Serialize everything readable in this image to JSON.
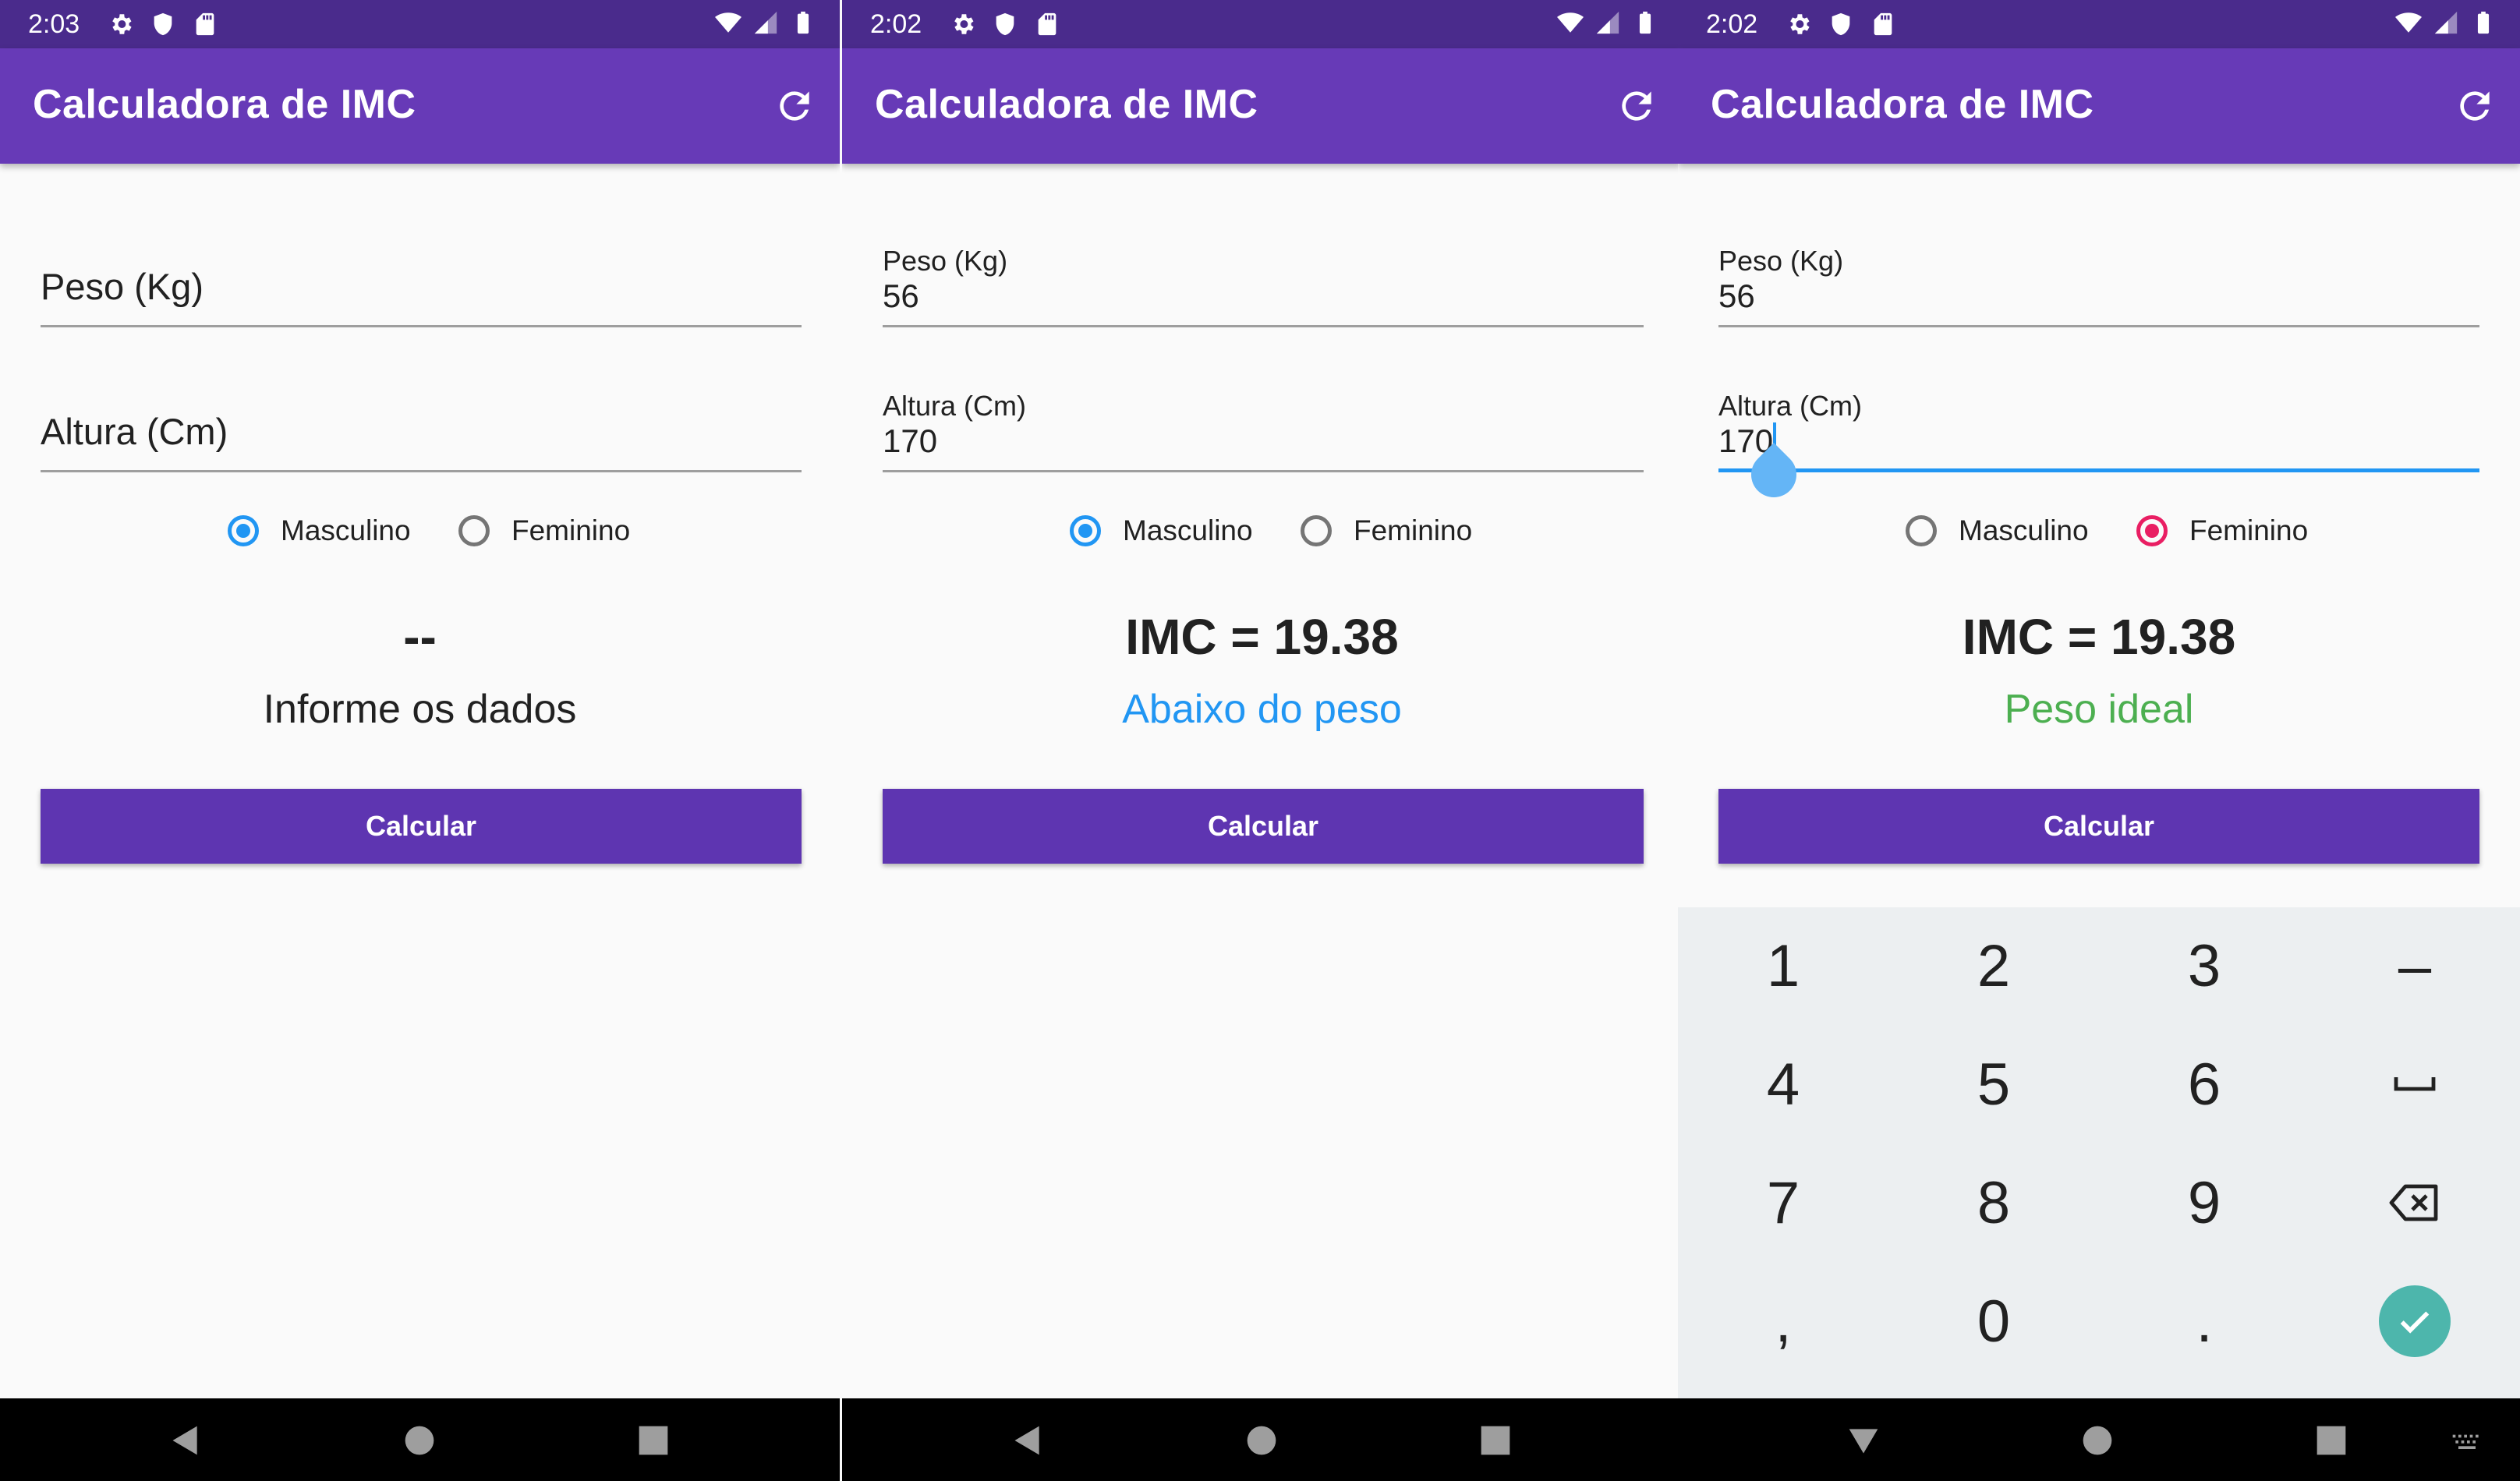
{
  "app": {
    "title": "Calculadora de IMC",
    "accent": "#673ab7",
    "button_color": "#5e35b1",
    "statusbar_color": "#4a2b8c"
  },
  "screens": [
    {
      "time": "2:03",
      "peso": {
        "label": "Peso (Kg)",
        "value": ""
      },
      "altura": {
        "label": "Altura (Cm)",
        "value": ""
      },
      "gender": {
        "masculino": "Masculino",
        "feminino": "Feminino",
        "selected": "masculino"
      },
      "result": "--",
      "status": "Informe os dados",
      "status_color": "#212121",
      "button": "Calcular"
    },
    {
      "time": "2:02",
      "peso": {
        "label": "Peso (Kg)",
        "value": "56"
      },
      "altura": {
        "label": "Altura (Cm)",
        "value": "170"
      },
      "gender": {
        "masculino": "Masculino",
        "feminino": "Feminino",
        "selected": "masculino"
      },
      "result": "IMC = 19.38",
      "status": "Abaixo do peso",
      "status_color": "#2196f3",
      "button": "Calcular"
    },
    {
      "time": "2:02",
      "peso": {
        "label": "Peso (Kg)",
        "value": "56"
      },
      "altura": {
        "label": "Altura (Cm)",
        "value": "170"
      },
      "gender": {
        "masculino": "Masculino",
        "feminino": "Feminino",
        "selected": "feminino"
      },
      "result": "IMC = 19.38",
      "status": "Peso ideal",
      "status_color": "#4caf50",
      "button": "Calcular"
    }
  ],
  "keyboard": {
    "keys": [
      "1",
      "2",
      "3",
      "–",
      "4",
      "5",
      "6",
      "7",
      "8",
      "9",
      ",",
      "0",
      "."
    ],
    "special": [
      "space-key-icon",
      "backspace-icon",
      "done-check-icon"
    ]
  }
}
